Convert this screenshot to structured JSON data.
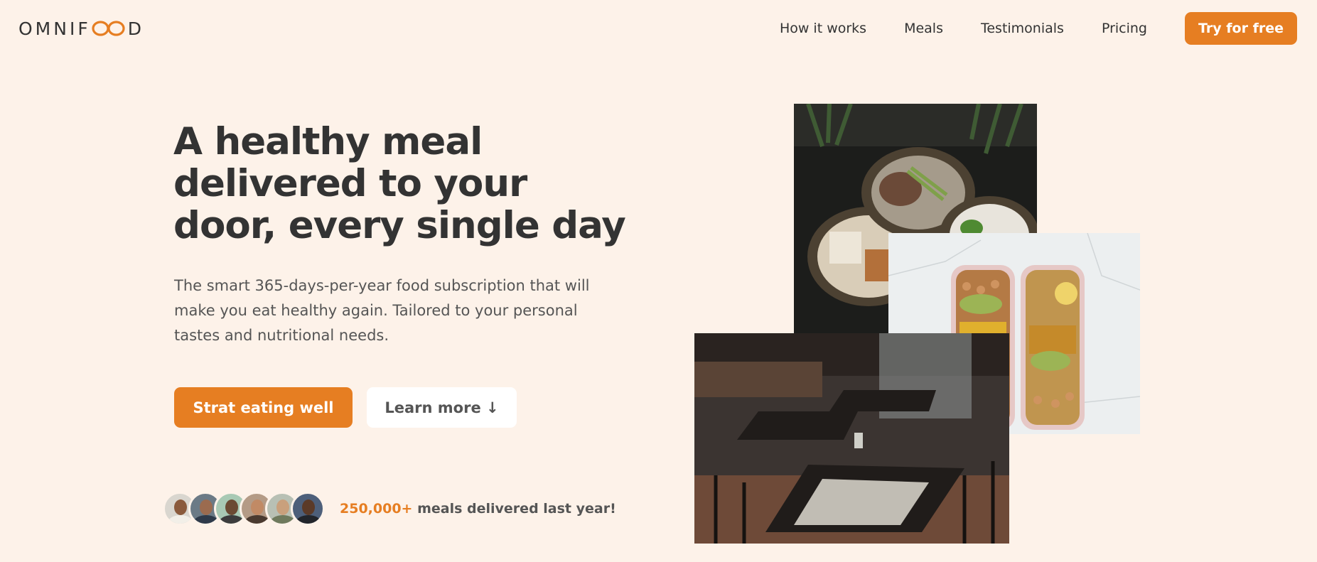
{
  "header": {
    "logo_text_left": "OMNIF",
    "logo_text_right": "D",
    "nav": [
      {
        "label": "How it works"
      },
      {
        "label": "Meals"
      },
      {
        "label": "Testimonials"
      },
      {
        "label": "Pricing"
      }
    ],
    "cta_label": "Try for free"
  },
  "hero": {
    "title": "A healthy meal delivered to your door, every single day",
    "description": "The smart 365-days-per-year food subscription that will make you eat healthy again. Tailored to your personal tastes and nutritional needs.",
    "primary_button": "Strat eating well",
    "secondary_button": "Learn more ↓",
    "delivered_count": "250,000+",
    "delivered_text": " meals delivered last year!"
  },
  "colors": {
    "background": "#fdf2e9",
    "accent": "#e67e22",
    "text": "#333333"
  }
}
